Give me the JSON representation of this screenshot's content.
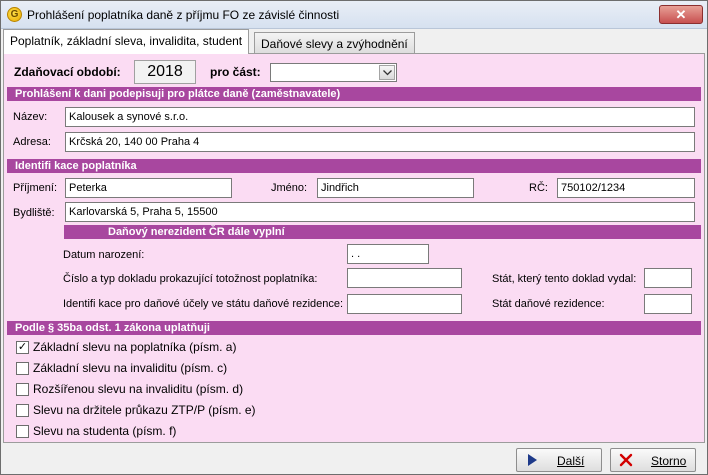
{
  "window": {
    "title": "Prohlášení poplatníka daně z příjmu FO ze závislé činnosti",
    "close_glyph": "✕"
  },
  "tabs": [
    {
      "label": "Poplatník, základní sleva, invalidita, student",
      "active": true
    },
    {
      "label": "Daňové  slevy a zvýhodnění",
      "active": false
    }
  ],
  "period": {
    "label": "Zdaňovací období:",
    "year": "2018",
    "part_label": "pro část:",
    "part_value": ""
  },
  "section_employer": {
    "title": "Prohlášení k dani podepisuji pro plátce daně (zaměstnavatele)",
    "name_label": "Název:",
    "name_value": "Kalousek a synové s.r.o.",
    "address_label": "Adresa:",
    "address_value": "Krčská 20, 140 00 Praha 4"
  },
  "section_taxpayer": {
    "title": "Identifi kace poplatníka",
    "surname_label": "Příjmení:",
    "surname_value": "Peterka",
    "firstname_label": "Jméno:",
    "firstname_value": "Jindřich",
    "rc_label": "RČ:",
    "rc_value": "750102/1234",
    "residence_label": "Bydliště:",
    "residence_value": "Karlovarská 5, Praha 5, 15500"
  },
  "section_nonresident": {
    "title": "Daňový nerezident ČR dále vyplní",
    "birthdate_label": "Datum narození:",
    "birthdate_value": " . .",
    "doc_label": "Číslo a typ dokladu prokazující totožnost poplatníka:",
    "doc_value": "",
    "doc_state_label": "Stát, který tento doklad vydal:",
    "doc_state_value": "",
    "taxid_label": "Identifi kace pro daňové účely ve státu daňové rezidence:",
    "taxid_value": "",
    "tax_state_label": "Stát daňové rezidence:",
    "tax_state_value": ""
  },
  "section_35ba": {
    "title": "Podle § 35ba odst. 1 zákona uplatňuji",
    "items": [
      {
        "label": "Základní slevu na poplatníka (písm. a)",
        "checked": true
      },
      {
        "label": "Základní slevu na invaliditu (písm. c)",
        "checked": false
      },
      {
        "label": "Rozšířenou slevu na invaliditu (písm. d)",
        "checked": false
      },
      {
        "label": "Slevu na držitele průkazu ZTP/P (písm. e)",
        "checked": false
      },
      {
        "label": "Slevu na studenta (písm. f)",
        "checked": false
      }
    ]
  },
  "buttons": {
    "next_label": "Další",
    "cancel_label": "Storno"
  },
  "colors": {
    "panel_background": "#fbdcf3",
    "section_header": "#a8479f",
    "next_icon": "#1e3a8a",
    "cancel_icon": "#d20000"
  },
  "icons": {
    "app": "app-icon",
    "close": "close-icon",
    "dropdown": "chevron-down-icon",
    "next": "play-arrow-icon",
    "cancel": "red-x-icon"
  }
}
